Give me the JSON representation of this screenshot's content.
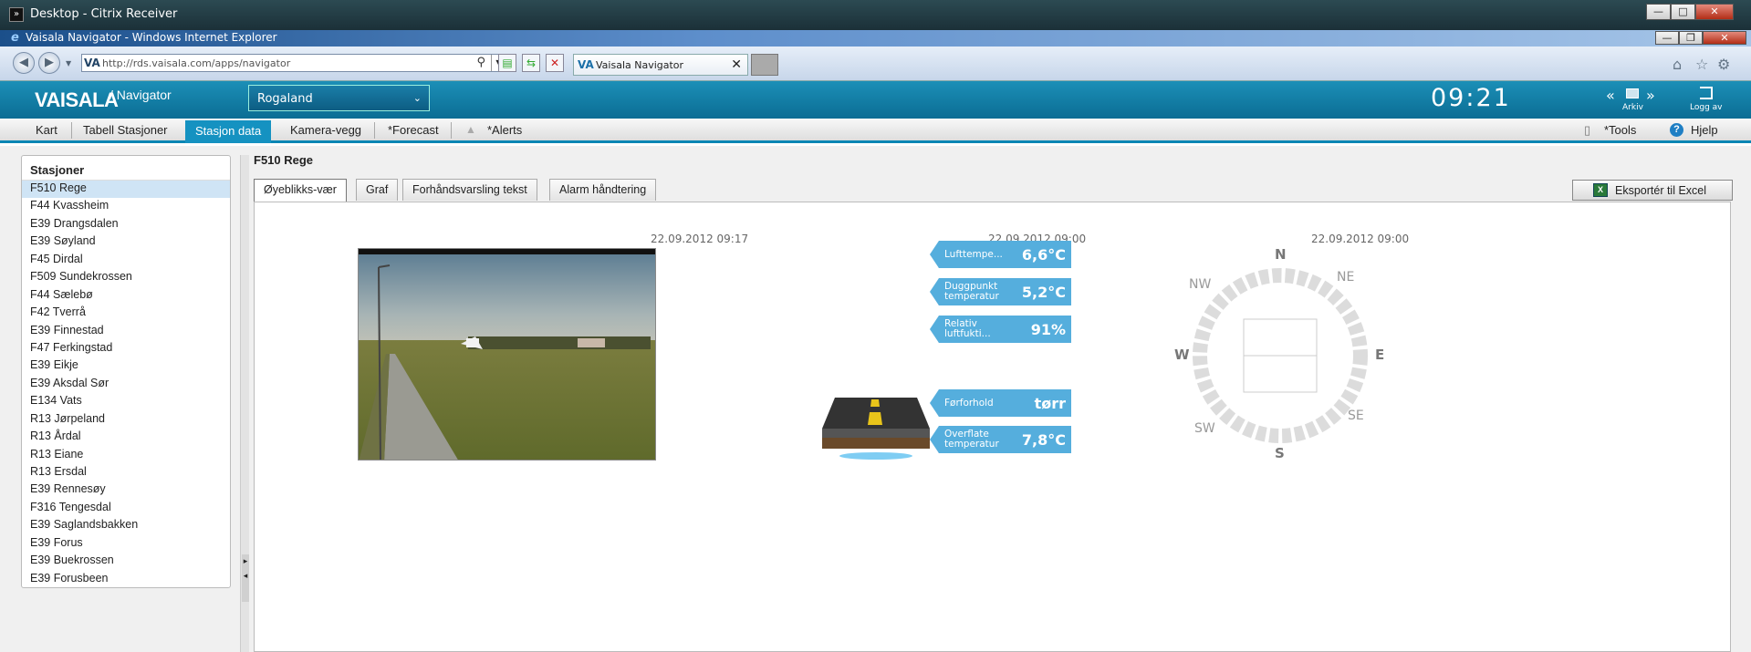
{
  "citrix": {
    "title": "Desktop - Citrix Receiver"
  },
  "ie": {
    "title": "Vaisala Navigator - Windows Internet Explorer",
    "address_prefix": "VA",
    "address_url": "http://rds.vaisala.com/apps/navigator",
    "tab_prefix": "VA",
    "tab_title": "Vaisala Navigator"
  },
  "app": {
    "logo": "VAISALA",
    "subtitle": "/ Navigator",
    "region": "Rogaland",
    "clock": "09:21",
    "archive_label": "Arkiv",
    "logout_label": "Logg av"
  },
  "menu": {
    "items": [
      "Kart",
      "Tabell Stasjoner",
      "Stasjon data",
      "Kamera-vegg",
      "*Forecast",
      "*Alerts"
    ],
    "active_index": 2,
    "tools": "*Tools",
    "help": "Hjelp"
  },
  "sidebar": {
    "title": "Stasjoner",
    "selected": "F510 Rege",
    "stations": [
      "F510 Rege",
      "F44 Kvassheim",
      "E39 Drangsdalen",
      "E39 Søyland",
      "F45 Dirdal",
      "F509 Sundekrossen",
      "F44 Sælebø",
      "F42 Tverrå",
      "E39 Finnestad",
      "F47 Ferkingstad",
      "E39 Eikje",
      "E39 Aksdal Sør",
      "E134 Vats",
      "R13 Jørpeland",
      "R13 Årdal",
      "R13 Eiane",
      "R13 Ersdal",
      "E39 Rennesøy",
      "F316 Tengesdal",
      "E39 Saglandsbakken",
      "E39 Forus",
      "E39 Buekrossen",
      "E39 Forusbeen"
    ]
  },
  "station": {
    "name": "F510 Rege",
    "tabs": [
      "Øyeblikks-vær",
      "Graf",
      "Forhåndsvarsling tekst",
      "Alarm håndtering"
    ],
    "active_tab": 0,
    "export_label": "Eksportér til Excel"
  },
  "camera": {
    "timestamp": "22.09.2012 09:17"
  },
  "weather": {
    "timestamp": "22.09.2012 09:00",
    "air_temp": {
      "label": "Lufttempe...",
      "value": "6,6°C"
    },
    "dew_point": {
      "label": "Duggpunkt temperatur",
      "value": "5,2°C"
    },
    "humidity": {
      "label": "Relativ luftfukti...",
      "value": "91%"
    },
    "road_condition": {
      "label": "Førforhold",
      "value": "tørr"
    },
    "surface_temp": {
      "label": "Overflate temperatur",
      "value": "7,8°C"
    }
  },
  "wind": {
    "timestamp": "22.09.2012 09:00",
    "directions": {
      "N": "N",
      "NE": "NE",
      "E": "E",
      "SE": "SE",
      "S": "S",
      "SW": "SW",
      "W": "W",
      "NW": "NW"
    }
  },
  "colors": {
    "header": "#0b7aa3",
    "accent": "#1592c1",
    "bubble": "#55aedd"
  }
}
